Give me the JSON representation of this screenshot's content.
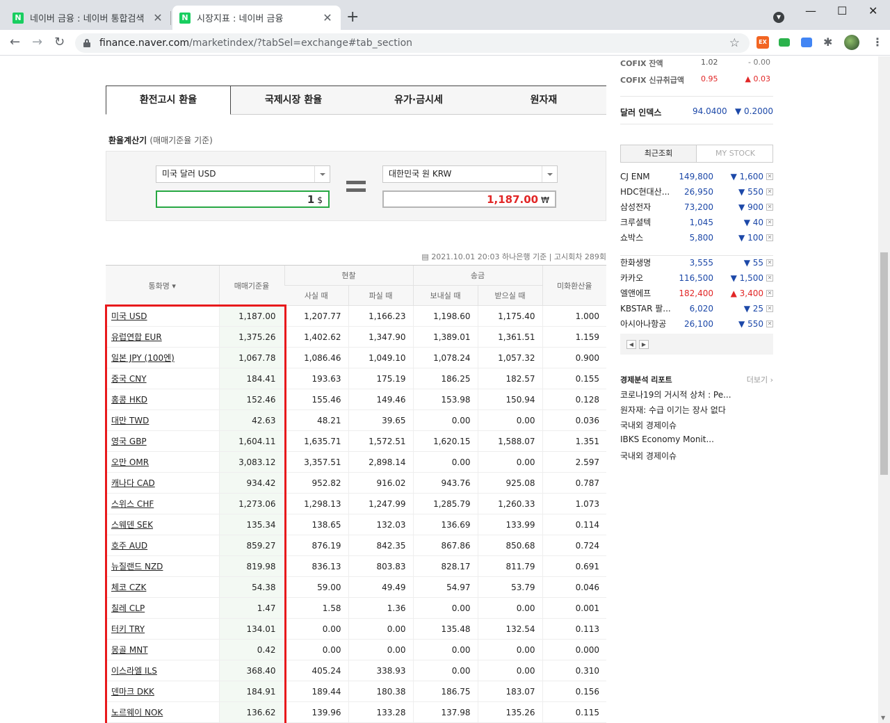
{
  "browser": {
    "tabs": [
      {
        "favicon": "N",
        "title": "네이버 금융 : 네이버 통합검색",
        "close": "✕"
      },
      {
        "favicon": "N",
        "title": "시장지표 : 네이버 금융",
        "close": "✕"
      }
    ],
    "new_tab": "+",
    "url_host": "finance.naver.com",
    "url_path": "/marketindex/?tabSel=exchange#tab_section",
    "extensions": [
      {
        "name": "exchange-extension-icon",
        "label": "EX",
        "color": "#f26522"
      },
      {
        "name": "green-extension-icon",
        "label": "",
        "color": "#2bb24c"
      },
      {
        "name": "blue-extension-icon",
        "label": "",
        "color": "#4285f4"
      }
    ],
    "icons": [
      "back-icon",
      "forward-icon",
      "reload-icon",
      "lock-icon",
      "star-icon",
      "puzzle-icon",
      "menu-icon",
      "minimize-icon",
      "maximize-icon",
      "close-icon",
      "tab-search-icon"
    ]
  },
  "main_tabs": [
    "환전고시 환율",
    "국제시장 환율",
    "유가·금시세",
    "원자재"
  ],
  "calculator": {
    "title": "환율계산기",
    "subtitle": "(매매기준율 기준)",
    "from_currency": "미국 달러 USD",
    "from_amount": "1",
    "from_unit": "$",
    "to_currency": "대한민국 원 KRW",
    "to_amount": "1,187.00",
    "to_unit": "₩"
  },
  "stamp": "2021.10.01 20:03  하나은행 기준 | 고시회차 289회",
  "table": {
    "headers": {
      "name": "통화명 ▾",
      "base": "매매기준율",
      "cash": "현찰",
      "cash_buy": "사실 때",
      "cash_sell": "파실 때",
      "wire": "송금",
      "wire_send": "보내실 때",
      "wire_recv": "받으실 때",
      "usd_rate": "미화환산율"
    },
    "rows": [
      {
        "name": "미국 USD",
        "base": "1,187.00",
        "cash_buy": "1,207.77",
        "cash_sell": "1,166.23",
        "send": "1,198.60",
        "recv": "1,175.40",
        "usd": "1.000"
      },
      {
        "name": "유럽연합 EUR",
        "base": "1,375.26",
        "cash_buy": "1,402.62",
        "cash_sell": "1,347.90",
        "send": "1,389.01",
        "recv": "1,361.51",
        "usd": "1.159"
      },
      {
        "name": "일본 JPY (100엔)",
        "base": "1,067.78",
        "cash_buy": "1,086.46",
        "cash_sell": "1,049.10",
        "send": "1,078.24",
        "recv": "1,057.32",
        "usd": "0.900"
      },
      {
        "name": "중국 CNY",
        "base": "184.41",
        "cash_buy": "193.63",
        "cash_sell": "175.19",
        "send": "186.25",
        "recv": "182.57",
        "usd": "0.155"
      },
      {
        "name": "홍콩 HKD",
        "base": "152.46",
        "cash_buy": "155.46",
        "cash_sell": "149.46",
        "send": "153.98",
        "recv": "150.94",
        "usd": "0.128"
      },
      {
        "name": "대만 TWD",
        "base": "42.63",
        "cash_buy": "48.21",
        "cash_sell": "39.65",
        "send": "0.00",
        "recv": "0.00",
        "usd": "0.036"
      },
      {
        "name": "영국 GBP",
        "base": "1,604.11",
        "cash_buy": "1,635.71",
        "cash_sell": "1,572.51",
        "send": "1,620.15",
        "recv": "1,588.07",
        "usd": "1.351"
      },
      {
        "name": "오만 OMR",
        "base": "3,083.12",
        "cash_buy": "3,357.51",
        "cash_sell": "2,898.14",
        "send": "0.00",
        "recv": "0.00",
        "usd": "2.597"
      },
      {
        "name": "캐나다 CAD",
        "base": "934.42",
        "cash_buy": "952.82",
        "cash_sell": "916.02",
        "send": "943.76",
        "recv": "925.08",
        "usd": "0.787"
      },
      {
        "name": "스위스 CHF",
        "base": "1,273.06",
        "cash_buy": "1,298.13",
        "cash_sell": "1,247.99",
        "send": "1,285.79",
        "recv": "1,260.33",
        "usd": "1.073"
      },
      {
        "name": "스웨덴 SEK",
        "base": "135.34",
        "cash_buy": "138.65",
        "cash_sell": "132.03",
        "send": "136.69",
        "recv": "133.99",
        "usd": "0.114"
      },
      {
        "name": "호주 AUD",
        "base": "859.27",
        "cash_buy": "876.19",
        "cash_sell": "842.35",
        "send": "867.86",
        "recv": "850.68",
        "usd": "0.724"
      },
      {
        "name": "뉴질랜드 NZD",
        "base": "819.98",
        "cash_buy": "836.13",
        "cash_sell": "803.83",
        "send": "828.17",
        "recv": "811.79",
        "usd": "0.691"
      },
      {
        "name": "체코 CZK",
        "base": "54.38",
        "cash_buy": "59.00",
        "cash_sell": "49.49",
        "send": "54.97",
        "recv": "53.79",
        "usd": "0.046"
      },
      {
        "name": "칠레 CLP",
        "base": "1.47",
        "cash_buy": "1.58",
        "cash_sell": "1.36",
        "send": "0.00",
        "recv": "0.00",
        "usd": "0.001"
      },
      {
        "name": "터키 TRY",
        "base": "134.01",
        "cash_buy": "0.00",
        "cash_sell": "0.00",
        "send": "135.48",
        "recv": "132.54",
        "usd": "0.113"
      },
      {
        "name": "몽골 MNT",
        "base": "0.42",
        "cash_buy": "0.00",
        "cash_sell": "0.00",
        "send": "0.00",
        "recv": "0.00",
        "usd": "0.000"
      },
      {
        "name": "이스라엘 ILS",
        "base": "368.40",
        "cash_buy": "405.24",
        "cash_sell": "338.93",
        "send": "0.00",
        "recv": "0.00",
        "usd": "0.310"
      },
      {
        "name": "덴마크 DKK",
        "base": "184.91",
        "cash_buy": "189.44",
        "cash_sell": "180.38",
        "send": "186.75",
        "recv": "183.07",
        "usd": "0.156"
      },
      {
        "name": "노르웨이 NOK",
        "base": "136.62",
        "cash_buy": "139.96",
        "cash_sell": "133.28",
        "send": "137.98",
        "recv": "135.26",
        "usd": "0.115"
      }
    ]
  },
  "sidebar": {
    "cofix": [
      {
        "label": "COFIX 잔액",
        "value": "1.02",
        "change": "- 0.00",
        "dir": "flat"
      },
      {
        "label": "COFIX 신규취급액",
        "value": "0.95",
        "change": "▲ 0.03",
        "dir": "up"
      }
    ],
    "dollar_index": {
      "label": "달러 인덱스",
      "value": "94.0400",
      "change": "▼ 0.2000"
    },
    "stock_tabs": [
      "최근조회",
      "MY STOCK"
    ],
    "stocks": [
      {
        "name": "CJ ENM",
        "price": "149,800",
        "change": "▼ 1,600",
        "dir": "down"
      },
      {
        "name": "HDC현대산...",
        "price": "26,950",
        "change": "▼ 550",
        "dir": "down"
      },
      {
        "name": "삼성전자",
        "price": "73,200",
        "change": "▼ 900",
        "dir": "down"
      },
      {
        "name": "크루셜텍",
        "price": "1,045",
        "change": "▼ 40",
        "dir": "down"
      },
      {
        "name": "쇼박스",
        "price": "5,800",
        "change": "▼ 100",
        "dir": "down"
      },
      {
        "name": "한화생명",
        "price": "3,555",
        "change": "▼ 55",
        "dir": "down"
      },
      {
        "name": "카카오",
        "price": "116,500",
        "change": "▼ 1,500",
        "dir": "down"
      },
      {
        "name": "엘앤에프",
        "price": "182,400",
        "change": "▲ 3,400",
        "dir": "up"
      },
      {
        "name": "KBSTAR 팔...",
        "price": "6,020",
        "change": "▼ 25",
        "dir": "down"
      },
      {
        "name": "아시아나항공",
        "price": "26,100",
        "change": "▼ 550",
        "dir": "down"
      }
    ],
    "pager_prev": "◀",
    "pager_next": "▶",
    "report_title": "경제분석 리포트",
    "report_more": "더보기 ›",
    "reports": [
      "코로나19의 거시적 상처 : Pe...",
      "원자재: 수급 이기는 장사 없다",
      "국내외 경제이슈",
      "IBKS Economy Monit...",
      "국내외 경제이슈"
    ]
  },
  "colors": {
    "up": "#e12626",
    "down": "#1c48a8",
    "highlight": "#e8191c",
    "to_amount": "#e12626"
  }
}
